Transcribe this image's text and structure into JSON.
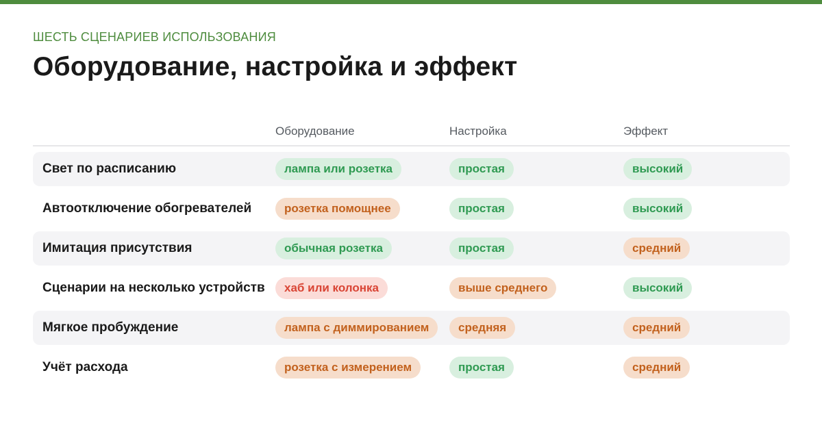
{
  "eyebrow": "ШЕСТЬ СЦЕНАРИЕВ ИСПОЛЬЗОВАНИЯ",
  "title": "Оборудование, настройка и эффект",
  "columns": [
    "Оборудование",
    "Настройка",
    "Эффект"
  ],
  "colors": {
    "accent": "#4e8c3e",
    "green_bg": "#d8efdf",
    "green_text": "#2f9a52",
    "orange_bg": "#f6ddcb",
    "orange_text": "#c2611d",
    "red_bg": "#fbdcd8",
    "red_text": "#d94535",
    "row_alt_bg": "#f4f4f6"
  },
  "rows": [
    {
      "label": "Свет по расписанию",
      "equipment": {
        "text": "лампа или розетка",
        "tone": "green"
      },
      "setup": {
        "text": "простая",
        "tone": "green"
      },
      "effect": {
        "text": "высокий",
        "tone": "green"
      }
    },
    {
      "label": "Автоотключение обогревателей",
      "equipment": {
        "text": "розетка помощнее",
        "tone": "orange"
      },
      "setup": {
        "text": "простая",
        "tone": "green"
      },
      "effect": {
        "text": "высокий",
        "tone": "green"
      }
    },
    {
      "label": "Имитация присутствия",
      "equipment": {
        "text": "обычная розетка",
        "tone": "green"
      },
      "setup": {
        "text": "простая",
        "tone": "green"
      },
      "effect": {
        "text": "средний",
        "tone": "orange"
      }
    },
    {
      "label": "Сценарии на несколько устройств",
      "equipment": {
        "text": "хаб или колонка",
        "tone": "red"
      },
      "setup": {
        "text": "выше среднего",
        "tone": "orange"
      },
      "effect": {
        "text": "высокий",
        "tone": "green"
      }
    },
    {
      "label": "Мягкое пробуждение",
      "equipment": {
        "text": "лампа с диммированием",
        "tone": "orange"
      },
      "setup": {
        "text": "средняя",
        "tone": "orange"
      },
      "effect": {
        "text": "средний",
        "tone": "orange"
      }
    },
    {
      "label": "Учёт расхода",
      "equipment": {
        "text": "розетка с измерением",
        "tone": "orange"
      },
      "setup": {
        "text": "простая",
        "tone": "green"
      },
      "effect": {
        "text": "средний",
        "tone": "orange"
      }
    }
  ]
}
